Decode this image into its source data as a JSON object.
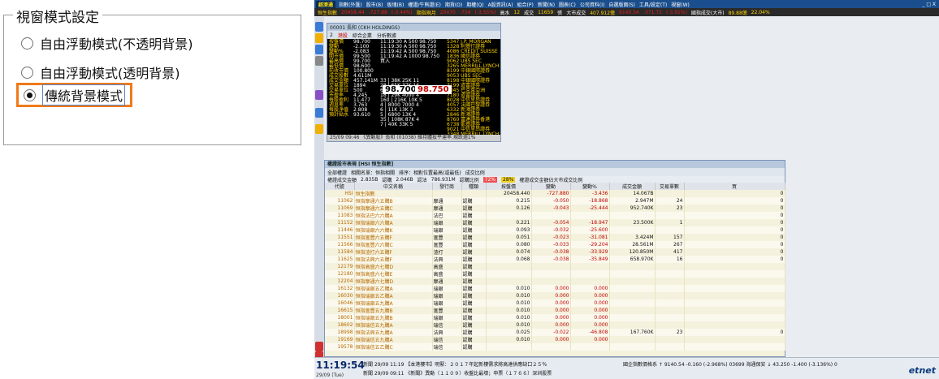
{
  "settings": {
    "legend": "視窗模式設定",
    "options": [
      {
        "label": "自由浮動模式(不透明背景)",
        "selected": false
      },
      {
        "label": "自由浮動模式(透明背景)",
        "selected": false
      },
      {
        "label": "傳統背景模式",
        "selected": true
      }
    ],
    "highlight_color": "#f07a1a"
  },
  "app": {
    "brand": "經濟通",
    "menu": [
      "指數(外匯)",
      "股市(B)",
      "板塊(B)",
      "權證/牛熊證(E)",
      "期貨(O)",
      "期權(Q)",
      "A股資訊(A)",
      "組合(P)",
      "新聞(N)",
      "圖表(C)",
      "公司資料(I)",
      "自選版面(S)",
      "工具/設定(T)",
      "視窗(W)"
    ],
    "window_controls": "_ □ X",
    "ticker": {
      "hsi_label": "恒生指數",
      "hsi_value": "20458.44",
      "hsi_change": "-727.88",
      "hsi_pct": "(-3.44%)",
      "fut_label": "期指現月",
      "fut_value": "20470",
      "fut_change": "-754",
      "fut_pct": "(-3.55%)",
      "prem_label": "高水",
      "prem_value": "12",
      "vol_label": "成交",
      "vol_value": "11659",
      "vol_unit": "張",
      "turnover_label": "大市成交",
      "turnover_value": "407.912億",
      "other_value": "9140.54",
      "other_change": "-371.72",
      "other_pct": "(-3.91%)",
      "extra_label": "國指成交(大市)",
      "extra_value": "89.88億",
      "extra_pct": "22.04%"
    },
    "quote": {
      "title": "00001 長和 (CKH HOLDINGS)",
      "toolbar": [
        "2",
        "港股",
        "綜合企業",
        "分析數據"
      ],
      "col1": [
        "按盤價",
        "變動",
        "變動%",
        "開市價",
        "最高價",
        "最低價",
        "前收市價",
        "成交股數",
        "成交金額",
        "交易單位",
        "交易單位",
        "市盈率",
        "每股盈利",
        "週息率",
        "每股淨值",
        "預計貼水"
      ],
      "col1_vals": [
        "98.700",
        "-2.100",
        "-2.083",
        "99.500",
        "99.700",
        "98.600",
        "100.800",
        "4.611M",
        "457.141M",
        "1894",
        "500",
        "4.245",
        "11.477",
        "3.763",
        "2.808",
        "93.610"
      ],
      "col2": [
        "11:19:30 A 500 98.750",
        "11:19:30 A 500 98.750",
        "11:19:42 A 500 98.750",
        "11:19:42 A 1000 98.750",
        "買入",
        "",
        "",
        "",
        "33 | 38K 25K 11",
        "28 | 65K 37K 16",
        "60 | 96K 18K 7",
        "18 | 29K 4000 4",
        "160 | 216K 10K 5",
        "4 | 8000 7000 4",
        "6 | 11K 13K 3",
        "5 | 6800 13K 4",
        "35 | 108K 87K 4",
        "7 | 40K 33K 5"
      ],
      "bid": "98.700",
      "ask": "98.750",
      "col3": [
        "5347 J.P. MORGAN",
        "1328 利豐行證券",
        "4086 CREDIT SUISSE",
        "1836 國信證券",
        "9062 UBS SEC",
        "3265 MERRILL LYNCH",
        "8199 中銀國際證券",
        "9053 UBS SEC",
        "8198 中銀國際證券",
        "7199 道富證券",
        "2045 巴克萊亞洲",
        "7180 道富證券",
        "8028 中信里昂證券",
        "4057 法國巴黎證券",
        "6332 新鴻證券",
        "2846 新鴻證券",
        "8760 富達證券香港",
        "6738 凱基證券",
        "9021 中信里昂證券",
        "3348 MERRILL LYNCH"
      ],
      "extra": [
        "歷史波幅率",
        "21.222",
        "買空(25/09)",
        "42.887M",
        "交易貨幣",
        "HKD",
        "買權最高",
        "111.100",
        "買賣差價",
        "0.050/0.050",
        "認購最低",
        "98.300",
        "HV"
      ],
      "status": "25/09 09:46 《異動股》長和 (01038) 維持體投平運率.現跌逾1%"
    },
    "wtable": {
      "title": "權證股市表現 [HSI 恒生指數]",
      "toolbar": [
        "全部權證",
        "相關名單：恒指相關",
        "排序：相對位置最高(或最低)",
        "成交比例"
      ],
      "summary": [
        "權證成交金額",
        "2.835B",
        "認購",
        "2.046B",
        "認沽",
        "786.931M",
        "認購比例",
        "72%",
        "28%",
        "權證成交金額佔大市成交比例"
      ],
      "headers": [
        "代號",
        "中文名稱",
        "發行商",
        "種類",
        "按盤價",
        "變動",
        "變動%",
        "成交金額",
        "交易單數",
        "買"
      ],
      "rows": [
        [
          "HSI",
          "恒生指數",
          "",
          "",
          "20458.440",
          "-727.880",
          "-3.436",
          "14.067B",
          "",
          "0"
        ],
        [
          "11062",
          "恒指摩通六五購B",
          "摩通",
          "認購",
          "0.215",
          "-0.050",
          "-18.868",
          "2.947M",
          "24",
          "0"
        ],
        [
          "11069",
          "恒指摩通六五購C",
          "摩通",
          "認購",
          "0.126",
          "-0.043",
          "-25.444",
          "952.740K",
          "23",
          "0"
        ],
        [
          "11083",
          "恒指法巴六六購A",
          "法巴",
          "認購",
          "",
          "",
          "",
          "",
          "",
          "0"
        ],
        [
          "11152",
          "恒指瑞銀六六購A",
          "瑞銀",
          "認購",
          "0.221",
          "-0.054",
          "-18.947",
          "23.500K",
          "1",
          "0"
        ],
        [
          "11446",
          "恒指瑞銀六六購K",
          "瑞銀",
          "認購",
          "0.093",
          "-0.032",
          "-25.600",
          "",
          "",
          "0"
        ],
        [
          "11551",
          "恒指滙豐六五購F",
          "滙豐",
          "認購",
          "0.051",
          "-0.023",
          "-31.081",
          "3.424M",
          "157",
          "0"
        ],
        [
          "11566",
          "恒指滙豐六六購C",
          "滙豐",
          "認購",
          "0.080",
          "-0.033",
          "-29.204",
          "28.561M",
          "267",
          "0"
        ],
        [
          "11584",
          "恒指渣打六五購F",
          "渣打",
          "認購",
          "0.074",
          "-0.038",
          "-33.929",
          "120.850M",
          "417",
          "0"
        ],
        [
          "11625",
          "恒指法興六五購F",
          "法興",
          "認購",
          "0.068",
          "-0.038",
          "-35.849",
          "658.970K",
          "16",
          "0"
        ],
        [
          "12179",
          "恒指高盛六七購D",
          "高盛",
          "認購",
          "",
          "",
          "",
          "",
          "",
          ""
        ],
        [
          "12180",
          "恒指高盛六七購E",
          "高盛",
          "認購",
          "",
          "",
          "",
          "",
          "",
          ""
        ],
        [
          "12204",
          "恒指摩通六七購D",
          "摩通",
          "認購",
          "",
          "",
          "",
          "",
          "",
          ""
        ],
        [
          "16132",
          "恒指瑞銀五乙購A",
          "瑞銀",
          "認購",
          "0.010",
          "0.000",
          "0.000",
          "",
          "",
          ""
        ],
        [
          "16030",
          "恒指瑞銀五乙購A",
          "瑞銀",
          "認購",
          "0.010",
          "0.000",
          "0.000",
          "",
          "",
          ""
        ],
        [
          "16046",
          "恒指瑞銀五九購A",
          "瑞銀",
          "認購",
          "0.010",
          "0.000",
          "0.000",
          "",
          "",
          ""
        ],
        [
          "16615",
          "恒指滙豐五九購B",
          "滙豐",
          "認購",
          "0.010",
          "0.000",
          "0.000",
          "",
          "",
          ""
        ],
        [
          "18001",
          "恒指瑞銀五九購B",
          "瑞銀",
          "認購",
          "0.010",
          "0.000",
          "0.000",
          "",
          "",
          ""
        ],
        [
          "18602",
          "恒指瑞信五九購A",
          "瑞信",
          "認購",
          "0.010",
          "0.000",
          "0.000",
          "",
          "",
          ""
        ],
        [
          "18998",
          "恒指法興五九購A",
          "法興",
          "認購",
          "0.025",
          "-0.022",
          "-46.808",
          "167.760K",
          "23",
          "0"
        ],
        [
          "19169",
          "恒指瑞信五九購A",
          "瑞信",
          "認購",
          "0.010",
          "0.000",
          "0.000",
          "",
          "",
          ""
        ],
        [
          "19578",
          "恒指瑞信五乙購C",
          "瑞信",
          "認購",
          "",
          "",
          "",
          "",
          "",
          ""
        ]
      ]
    },
    "news": {
      "time": "11:19:54",
      "date": "29/09 (Tue)",
      "line1": "新聞 29/09 11:19 【本港樓市】明緊：２０１７年起新樓需求將高達供應缺口２５％",
      "line2": "新聞 29/09 09:11 《新聞》異動（１１０９）收盤比最壞；申票（１７６６）深圳股票",
      "idx": "國企指數價格系 ↑ 9140.54 -0.160 (-2.968%) 03699 海通保安 ↓ 43.250 -1.400 (-3.136%) 0",
      "logo": "etnet"
    }
  }
}
